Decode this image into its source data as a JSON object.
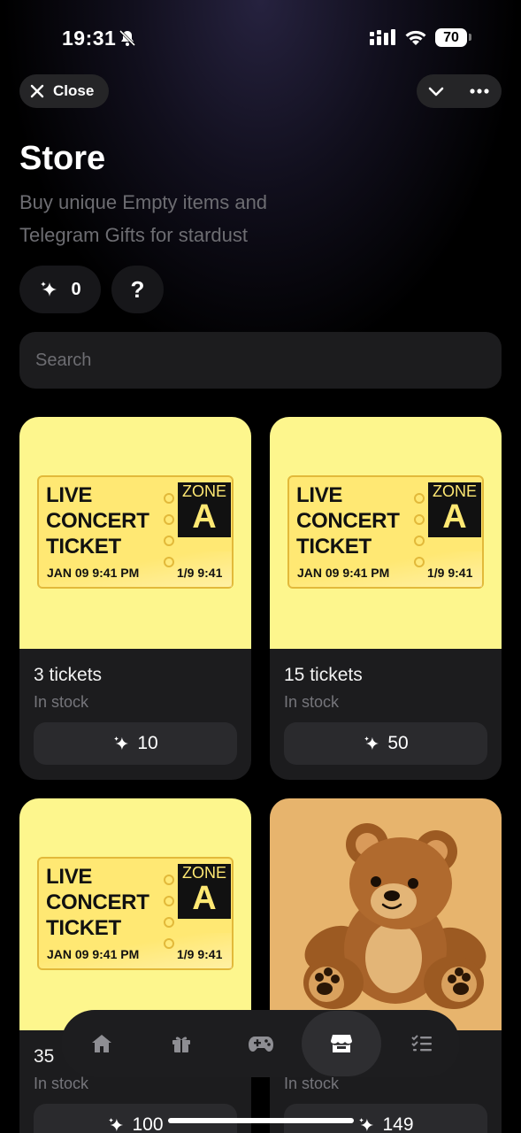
{
  "status_bar": {
    "time": "19:31",
    "battery": "70"
  },
  "header": {
    "close_label": "Close"
  },
  "page": {
    "title": "Store",
    "subtitle": "Buy unique Empty items and Telegram Gifts for stardust"
  },
  "balance": {
    "value": "0",
    "help": "?"
  },
  "search": {
    "placeholder": "Search"
  },
  "ticket_art": {
    "line1": "LIVE",
    "line2": "CONCERT",
    "line3": "TICKET",
    "zone_label": "ZONE",
    "zone_letter": "A",
    "date": "JAN 09   9:41 PM",
    "date_short": "1/9  9:41"
  },
  "items": [
    {
      "name": "3 tickets",
      "stock": "In stock",
      "price": "10"
    },
    {
      "name": "15 tickets",
      "stock": "In stock",
      "price": "50"
    },
    {
      "name": "35",
      "stock": "In stock",
      "price": "100"
    },
    {
      "name": "",
      "stock": "In stock",
      "price": "149"
    }
  ],
  "nav": [
    "home-icon",
    "gift-icon",
    "gamepad-icon",
    "store-icon",
    "tasks-icon"
  ],
  "colors": {
    "ticket_bg": "#fdf68d",
    "bear_bg": "#e7b46d",
    "card_bg": "#1c1c1e"
  }
}
